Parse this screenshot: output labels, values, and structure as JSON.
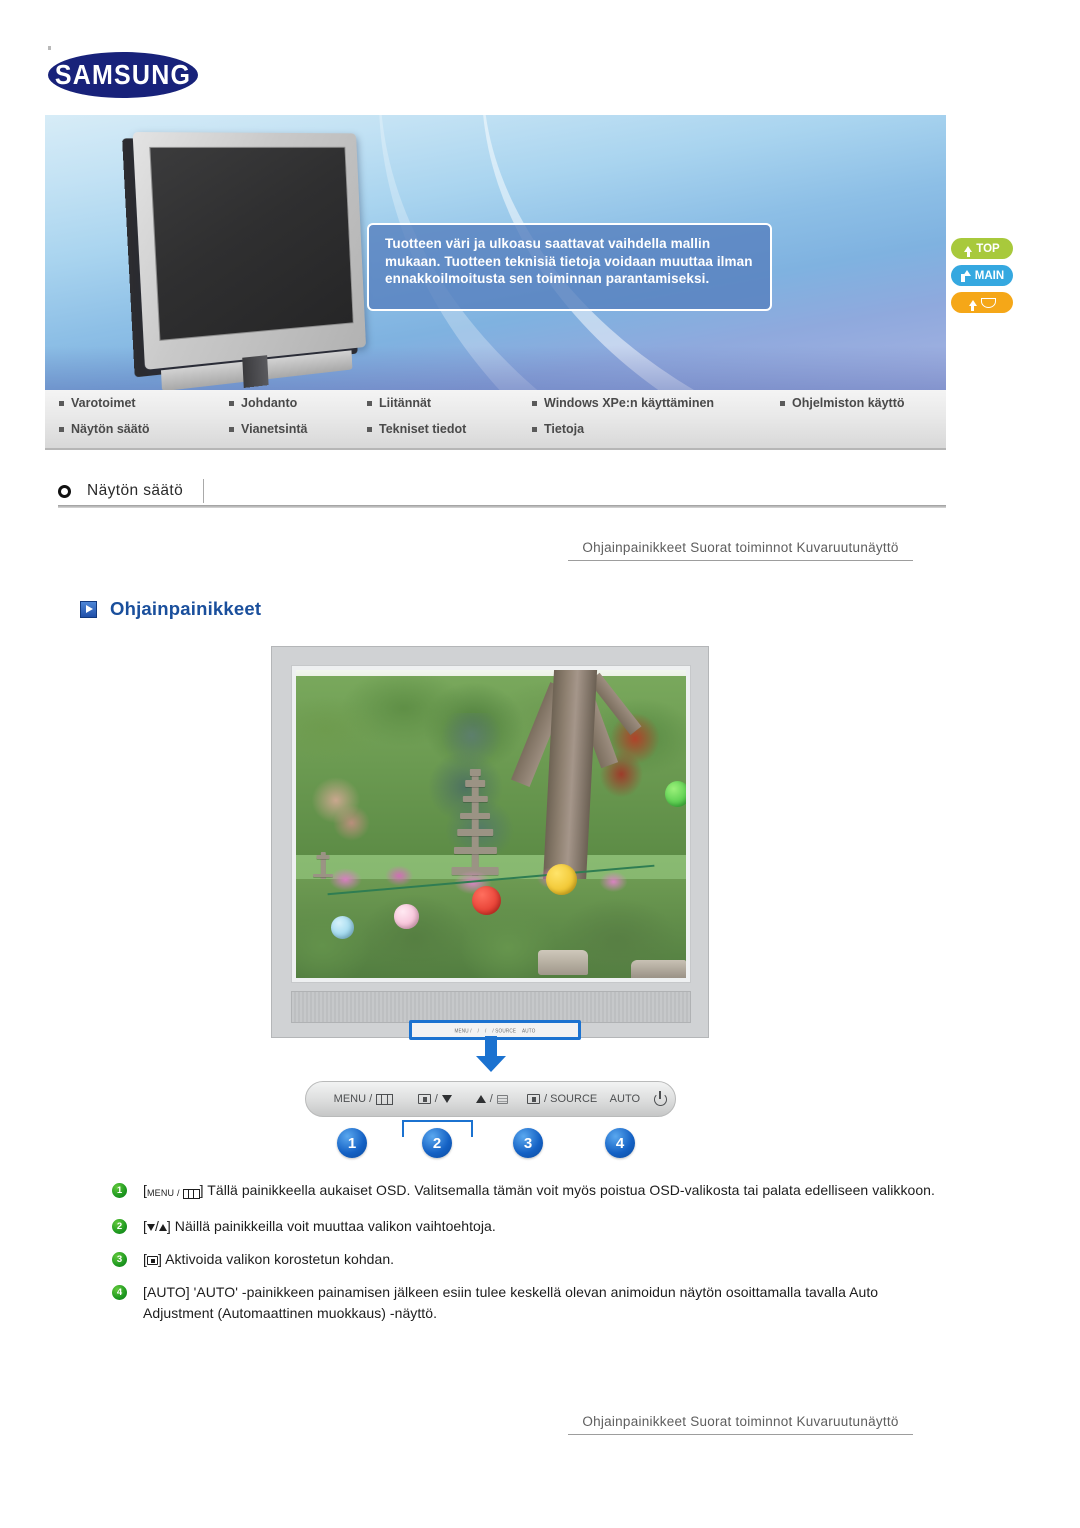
{
  "brand": {
    "logo_text": "SAMSUNG"
  },
  "hero": {
    "note": "Tuotteen väri ja ulkoasu saattavat vaihdella mallin mukaan. Tuotteen teknisiä tietoja voidaan muuttaa ilman ennakkoilmoitusta sen toiminnan parantamiseksi."
  },
  "side_buttons": [
    {
      "label": "TOP",
      "icon": "arrow-up-icon",
      "color": "#a8c93c"
    },
    {
      "label": "MAIN",
      "icon": "arrow-branch-icon",
      "color": "#35a8e0"
    },
    {
      "label": "",
      "icon": "arrow-up-smile-icon",
      "color": "#f5a718"
    }
  ],
  "nav": {
    "row1": [
      {
        "label": "Varotoimet"
      },
      {
        "label": "Johdanto"
      },
      {
        "label": "Liitännät"
      },
      {
        "label": "Windows XPe:n käyttäminen"
      },
      {
        "label": "Ohjelmiston käyttö"
      }
    ],
    "row2": [
      {
        "label": "Näytön säätö"
      },
      {
        "label": "Vianetsintä"
      },
      {
        "label": "Tekniset tiedot"
      },
      {
        "label": "Tietoja"
      }
    ]
  },
  "section": {
    "title": "Näytön säätö",
    "icon": "ring-icon"
  },
  "breadcrumb": {
    "text": "Ohjainpainikkeet  Suorat toiminnot  Kuvaruutunäyttö"
  },
  "heading": {
    "text": "Ohjainpainikkeet",
    "icon": "blue-play-icon"
  },
  "figure": {
    "caption_strip": [
      "MENU /",
      "/",
      "/",
      "/ SOURCE",
      "AUTO"
    ],
    "photo_alt": "Puutarhakuva: kivipagodi, puu ja värikkäitä lyhtyjä"
  },
  "panel": {
    "buttons": [
      {
        "label": "MENU /",
        "icon": "menu-bars-icon"
      },
      {
        "label": "/",
        "icon": "enter-box-icon-down-triangle"
      },
      {
        "label": "/",
        "icon": "up-triangle-lines-icon"
      },
      {
        "label": "/ SOURCE",
        "icon": "source-box-icon"
      },
      {
        "label": "AUTO",
        "icon": "auto-text"
      },
      {
        "label": "",
        "icon": "power-icon"
      }
    ]
  },
  "badges": [
    "1",
    "2",
    "3",
    "4"
  ],
  "descriptions": [
    {
      "num": "1",
      "prefix_open": "[",
      "icon_word": "MENU /",
      "icon": "menu-bars-icon",
      "prefix_close": "]",
      "text": " Tällä painikkeella aukaiset OSD. Valitsemalla tämän voit myös poistua OSD-valikosta tai palata edelliseen valikkoon."
    },
    {
      "num": "2",
      "prefix_open": "[",
      "icon": "down-up-triangles-icon",
      "prefix_close": "]",
      "text": " Näillä painikkeilla voit muuttaa valikon vaihtoehtoja."
    },
    {
      "num": "3",
      "prefix_open": "[",
      "icon": "enter-box-icon",
      "prefix_close": "]",
      "text": " Aktivoida valikon korostetun kohdan."
    },
    {
      "num": "4",
      "prefix_open": "[AUTO]",
      "text": " 'AUTO' -painikkeen painamisen jälkeen esiin tulee keskellä olevan animoidun näytön osoittamalla tavalla Auto Adjustment (Automaattinen muokkaus) -näyttö."
    }
  ]
}
